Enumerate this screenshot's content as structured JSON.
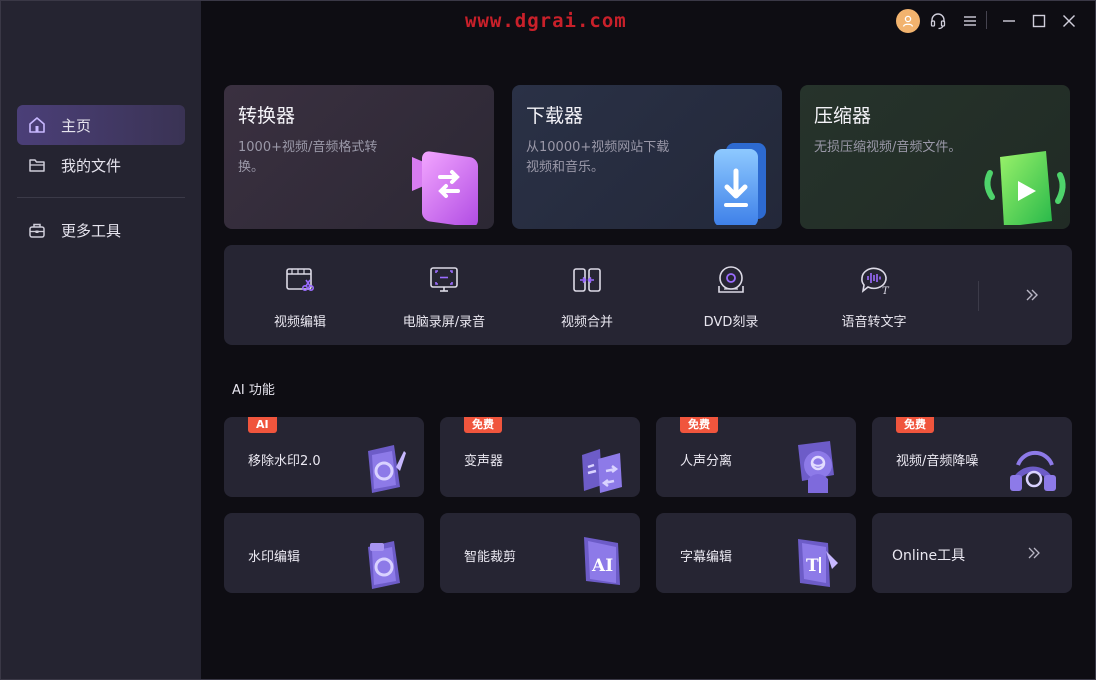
{
  "watermark": "www.dgrai.com",
  "titlebar": {
    "icons": [
      "avatar-icon",
      "headset-icon",
      "menu-icon",
      "minimize-icon",
      "maximize-icon",
      "close-icon"
    ]
  },
  "sidebar": {
    "items": [
      {
        "label": "主页",
        "icon": "home-icon",
        "active": true
      },
      {
        "label": "我的文件",
        "icon": "folder-icon",
        "active": false
      },
      {
        "label": "更多工具",
        "icon": "toolbox-icon",
        "active": false
      }
    ]
  },
  "features": [
    {
      "title": "转换器",
      "desc": "1000+视频/音频格式转换。",
      "icon": "converter-icon"
    },
    {
      "title": "下载器",
      "desc": "从10000+视频网站下载视频和音乐。",
      "icon": "downloader-icon"
    },
    {
      "title": "压缩器",
      "desc": "无损压缩视频/音频文件。",
      "icon": "compressor-icon"
    }
  ],
  "tools": [
    {
      "label": "视频编辑",
      "icon": "video-edit-icon"
    },
    {
      "label": "电脑录屏/录音",
      "icon": "screen-record-icon"
    },
    {
      "label": "视频合并",
      "icon": "video-merge-icon"
    },
    {
      "label": "DVD刻录",
      "icon": "dvd-burn-icon"
    },
    {
      "label": "语音转文字",
      "icon": "speech-to-text-icon"
    }
  ],
  "ai_section": {
    "title": "AI 功能",
    "cards": [
      {
        "label": "移除水印2.0",
        "badge": "AI"
      },
      {
        "label": "变声器",
        "badge": "免费"
      },
      {
        "label": "人声分离",
        "badge": "免费"
      },
      {
        "label": "视频/音频降噪",
        "badge": "免费"
      },
      {
        "label": "水印编辑",
        "badge": ""
      },
      {
        "label": "智能裁剪",
        "badge": ""
      },
      {
        "label": "字幕编辑",
        "badge": ""
      },
      {
        "label": "Online工具",
        "badge": ""
      }
    ]
  },
  "colors": {
    "accent": "#8b5cf6",
    "badge": "#f0553d",
    "watermark": "#c9202a"
  }
}
